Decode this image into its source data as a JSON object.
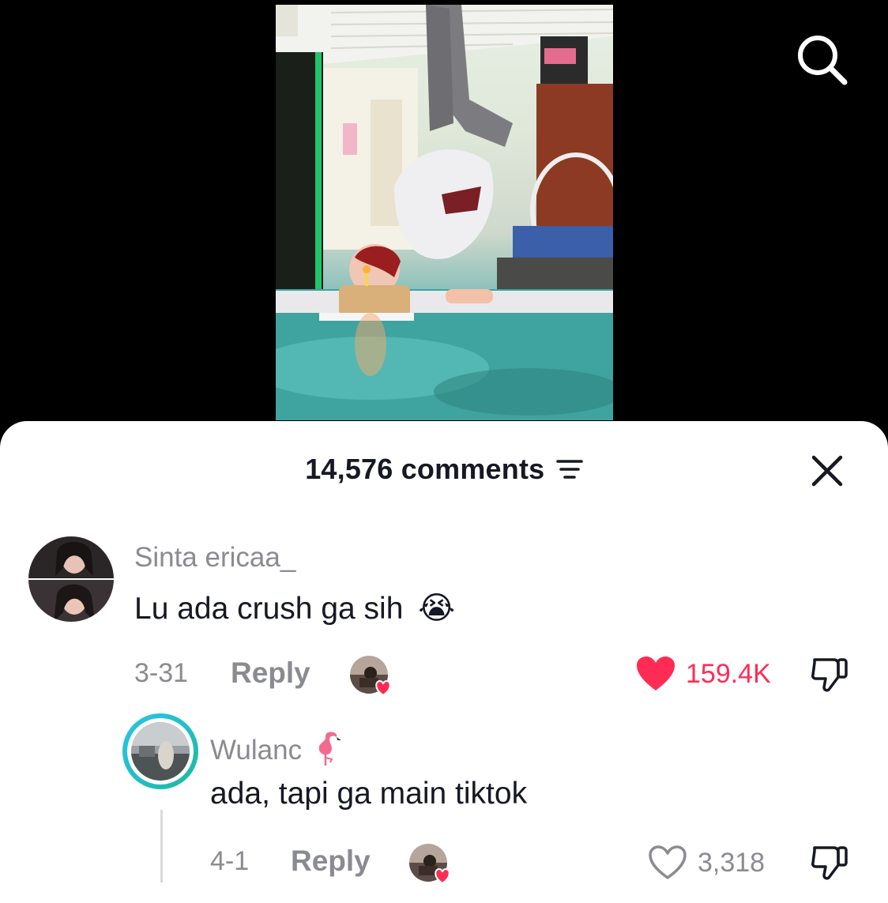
{
  "header": {
    "comments_count": "14,576 comments",
    "sort_icon": "sort-lines-icon",
    "close_icon": "close-x-icon"
  },
  "top": {
    "search_icon": "search-icon"
  },
  "comments": [
    {
      "username": "Sinta ericaa_",
      "text": "Lu ada crush ga sih",
      "emoji": "😭",
      "date": "3-31",
      "reply_label": "Reply",
      "likes": "159.4K",
      "liked": true
    },
    {
      "username": "Wulanc",
      "text": "ada, tapi ga main tiktok",
      "date": "4-1",
      "reply_label": "Reply",
      "likes": "3,318",
      "liked": false
    }
  ],
  "colors": {
    "like_red": "#fe2c55",
    "text_primary": "#161823",
    "text_secondary": "#8a8b91",
    "story_ring_start": "#27c6e8",
    "story_ring_end": "#1fb8a0"
  }
}
